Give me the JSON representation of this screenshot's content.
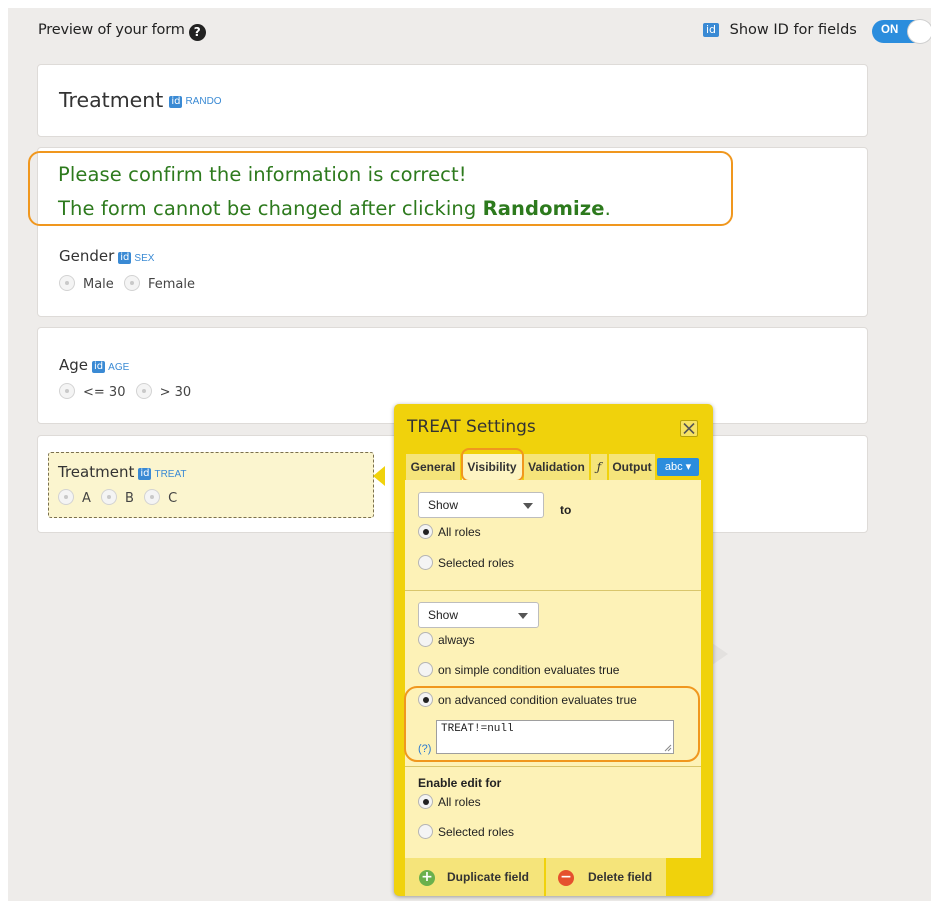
{
  "header": {
    "title": "Preview of your form",
    "help_icon": "?",
    "id_badge": "id",
    "show_id_label": "Show ID for fields",
    "toggle_label": "ON"
  },
  "cards": {
    "treatment_header": {
      "title": "Treatment",
      "id_badge": "id",
      "id_tag": "RANDO"
    },
    "message": {
      "line1": "Please confirm the information is correct!",
      "line2_prefix": "The form cannot be changed after clicking ",
      "line2_bold": "Randomize",
      "line2_suffix": "."
    },
    "gender": {
      "label": "Gender",
      "id_badge": "id",
      "id_tag": "SEX",
      "options": [
        "Male",
        "Female"
      ]
    },
    "age": {
      "label": "Age",
      "id_badge": "id",
      "id_tag": "AGE",
      "options": [
        "<= 30",
        "> 30"
      ]
    },
    "treatment": {
      "label": "Treatment",
      "id_badge": "id",
      "id_tag": "TREAT",
      "options": [
        "A",
        "B",
        "C"
      ]
    }
  },
  "settings": {
    "title": "TREAT Settings",
    "tabs": [
      "General",
      "Visibility",
      "Validation",
      "ƒ",
      "Output"
    ],
    "active_tab": "Visibility",
    "abc_dropdown": "abc ▾",
    "show_select": "Show",
    "to_label": "to",
    "role_options": [
      "All roles",
      "Selected roles"
    ],
    "condition_select": "Show",
    "condition_options": [
      "always",
      "on simple condition evaluates true",
      "on advanced condition evaluates true"
    ],
    "selected_condition": "on advanced condition evaluates true",
    "condition_expression": "TREAT!=null",
    "help_link": "(?)",
    "enable_edit_label": "Enable edit for",
    "enable_roles": [
      "All roles",
      "Selected roles"
    ],
    "duplicate_button": "Duplicate field",
    "delete_button": "Delete field"
  },
  "colors": {
    "accent_blue": "#2b8ddd",
    "highlight_orange": "#f0971e",
    "message_green": "#2d7a1d",
    "panel_yellow": "#f0d20c",
    "panel_body": "#fdf2b7"
  }
}
